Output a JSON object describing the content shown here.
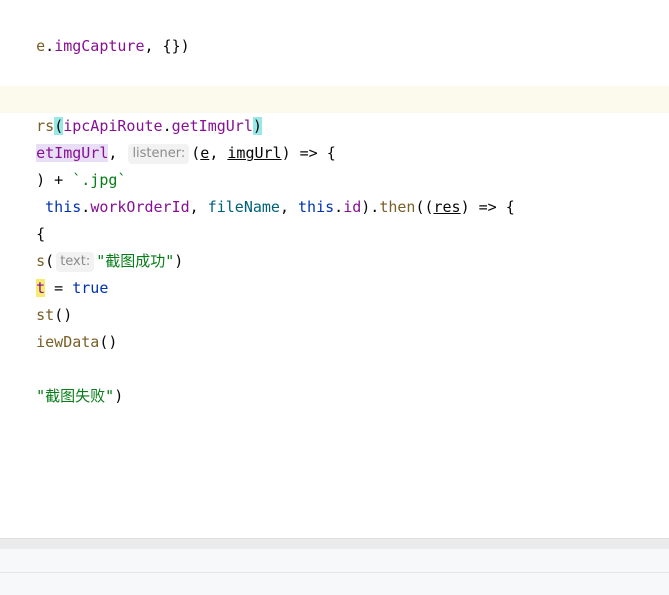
{
  "code": {
    "l1": {
      "a": "e",
      "b": ".",
      "c": "imgCapture",
      "d": ", {})"
    },
    "l4": {
      "a": "rs",
      "b": "(",
      "c": "ipcApiRoute",
      "d": ".",
      "e": "getImgUrl",
      "f": ")"
    },
    "l5": {
      "a": "etImgUrl",
      "b": ", ",
      "hint": "listener:",
      "c": "(",
      "d": "e",
      "e": ", ",
      "f": "imgUrl",
      "g": ") => {"
    },
    "l6": {
      "a": ") + ",
      "b": "`.jpg`"
    },
    "l7": {
      "a": " ",
      "b": "this",
      "c": ".",
      "d": "workOrderId",
      "e": ", ",
      "f": "fileName",
      "g": ", ",
      "h": "this",
      "i": ".",
      "j": "id",
      "k": ").",
      "l": "then",
      "m": "((",
      "n": "res",
      "o": ") => {"
    },
    "l8": {
      "a": "{"
    },
    "l9": {
      "a": "s",
      "b": "(",
      "hint": "text:",
      "c": "\"截图成功\"",
      "d": ")"
    },
    "l10": {
      "a": "t",
      "b": " = ",
      "c": "true"
    },
    "l11": {
      "a": "st",
      "b": "()"
    },
    "l12": {
      "a": "iewData",
      "b": "()"
    },
    "l14": {
      "a": "\"截图失败\"",
      "b": ")"
    }
  }
}
